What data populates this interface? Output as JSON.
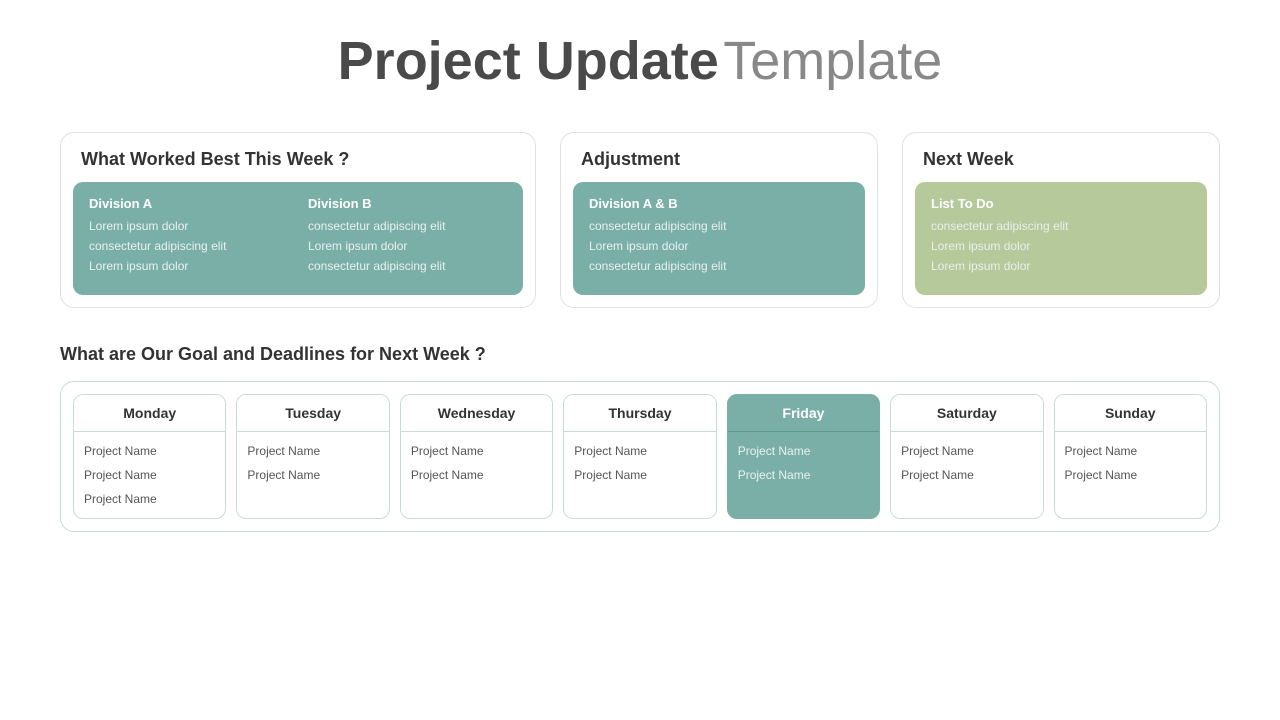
{
  "title": {
    "bold": "Project Update",
    "light": "Template"
  },
  "top_cards": [
    {
      "id": "what-worked",
      "header": "What Worked Best This Week ?",
      "type": "teal-two-col",
      "columns": [
        {
          "title": "Division A",
          "items": [
            "Lorem ipsum dolor",
            "consectetur adipiscing elit",
            "Lorem ipsum dolor"
          ]
        },
        {
          "title": "Division B",
          "items": [
            "consectetur adipiscing elit",
            "Lorem ipsum dolor",
            "consectetur adipiscing elit"
          ]
        }
      ]
    },
    {
      "id": "adjustment",
      "header": "Adjustment",
      "type": "teal-one-col",
      "columns": [
        {
          "title": "Division A & B",
          "items": [
            "consectetur adipiscing elit",
            "Lorem ipsum dolor",
            "consectetur adipiscing elit"
          ]
        }
      ]
    },
    {
      "id": "next-week",
      "header": "Next Week",
      "type": "green-one-col",
      "columns": [
        {
          "title": "List To Do",
          "items": [
            "consectetur adipiscing elit",
            "Lorem ipsum dolor",
            "Lorem ipsum dolor"
          ]
        }
      ]
    }
  ],
  "goals_section": {
    "title": "What are Our Goal and Deadlines for Next Week ?",
    "days": [
      {
        "name": "Monday",
        "active": false,
        "projects": [
          "Project Name",
          "Project Name",
          "Project Name"
        ]
      },
      {
        "name": "Tuesday",
        "active": false,
        "projects": [
          "Project Name",
          "Project Name"
        ]
      },
      {
        "name": "Wednesday",
        "active": false,
        "projects": [
          "Project Name",
          "Project Name"
        ]
      },
      {
        "name": "Thursday",
        "active": false,
        "projects": [
          "Project Name",
          "Project Name"
        ]
      },
      {
        "name": "Friday",
        "active": true,
        "projects": [
          "Project Name",
          "Project Name"
        ]
      },
      {
        "name": "Saturday",
        "active": false,
        "projects": [
          "Project Name",
          "Project Name"
        ]
      },
      {
        "name": "Sunday",
        "active": false,
        "projects": [
          "Project Name",
          "Project Name"
        ]
      }
    ]
  }
}
